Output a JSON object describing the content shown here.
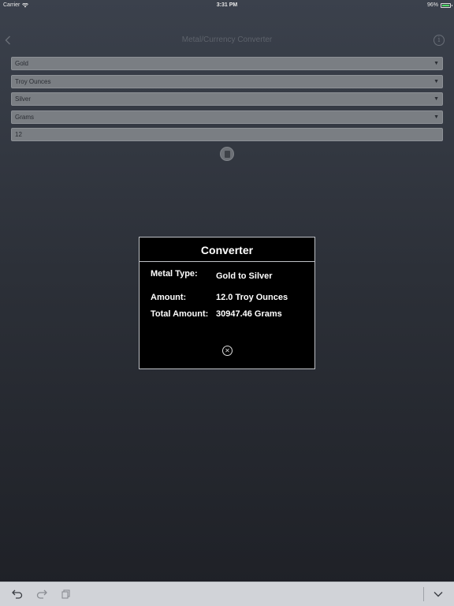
{
  "status_bar": {
    "carrier": "Carrier",
    "time": "3:31 PM",
    "battery": "96%",
    "battery_level": 0.96
  },
  "nav": {
    "title": "Metal/Currency Converter"
  },
  "form": {
    "from_metal": "Gold",
    "from_unit": "Troy Ounces",
    "to_metal": "Silver",
    "to_unit": "Grams",
    "amount": "12"
  },
  "modal": {
    "title": "Converter",
    "metal_type_label": "Metal Type:",
    "metal_type_value": "Gold to Silver",
    "amount_label": "Amount:",
    "amount_value": "12.0 Troy Ounces",
    "total_label": "Total Amount:",
    "total_value": "30947.46 Grams"
  },
  "colors": {
    "battery": "#4cd964",
    "modal_bg": "#000000",
    "field_bg": "#7a7e83"
  }
}
